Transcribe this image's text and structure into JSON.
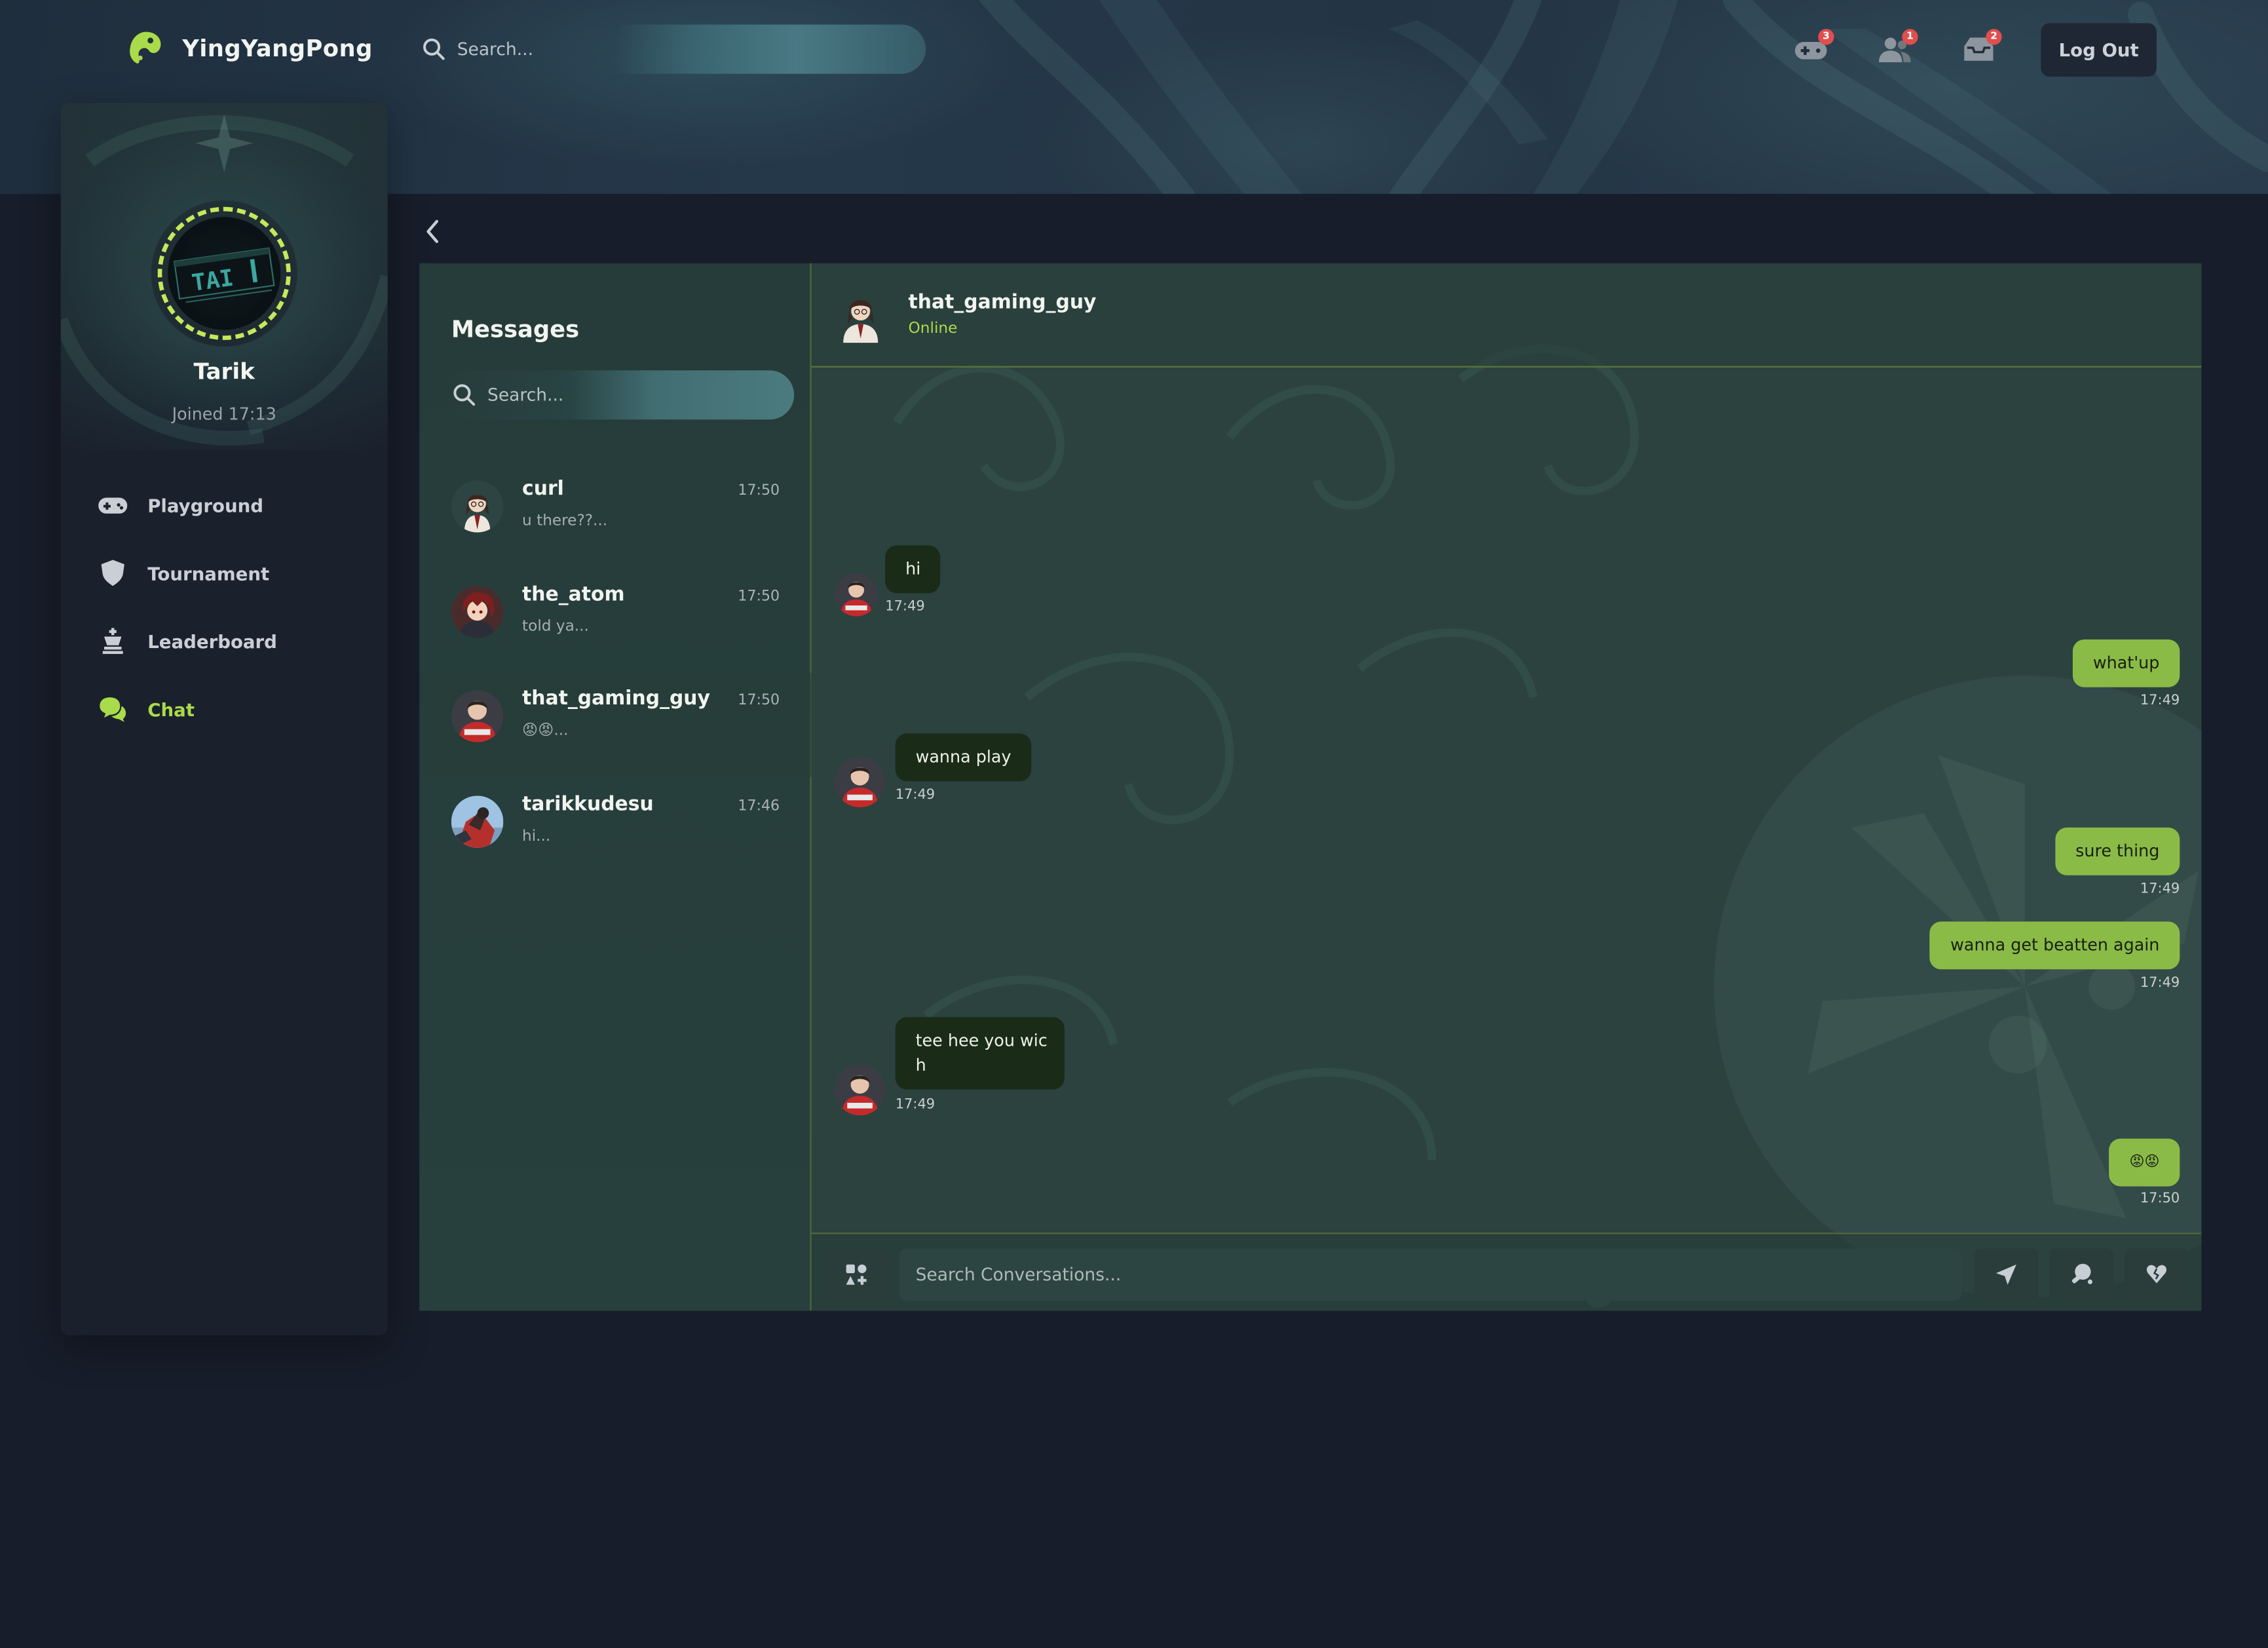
{
  "app": {
    "name": "YingYangPong"
  },
  "topbar": {
    "search_placeholder": "Search...",
    "badges": {
      "games": "3",
      "friends": "1",
      "inbox": "2"
    },
    "logout_label": "Log Out"
  },
  "profile": {
    "name": "Tarik",
    "joined": "Joined 17:13"
  },
  "sidebar": {
    "items": [
      {
        "label": "Playground",
        "icon": "gamepad-icon"
      },
      {
        "label": "Tournament",
        "icon": "shield-icon"
      },
      {
        "label": "Leaderboard",
        "icon": "chess-king-icon"
      },
      {
        "label": "Chat",
        "icon": "chat-bubbles-icon"
      }
    ]
  },
  "conversations": {
    "title": "Messages",
    "search_placeholder": "Search...",
    "items": [
      {
        "name": "curl",
        "time": "17:50",
        "preview": "u there??..."
      },
      {
        "name": "the_atom",
        "time": "17:50",
        "preview": "told ya..."
      },
      {
        "name": "that_gaming_guy",
        "time": "17:50",
        "preview": "😡😡..."
      },
      {
        "name": "tarikkudesu",
        "time": "17:46",
        "preview": "hi..."
      }
    ]
  },
  "chat": {
    "contact_name": "that_gaming_guy",
    "status": "Online",
    "messages": [
      {
        "text": "hi",
        "time": "17:49"
      },
      {
        "text": "what'up",
        "time": "17:49"
      },
      {
        "text": "wanna play",
        "time": "17:49"
      },
      {
        "text": "sure thing",
        "time": "17:49"
      },
      {
        "text": "wanna get beatten again",
        "time": "17:49"
      },
      {
        "text": "tee hee you wic",
        "text2": "h",
        "time": "17:49"
      },
      {
        "text": "😡😡",
        "time": "17:50"
      }
    ],
    "composer_placeholder": "Search Conversations..."
  },
  "colors": {
    "accent": "#a9db4a",
    "bubble_out": "#8bbb47",
    "bubble_in": "#1a2b18",
    "badge": "#e04e4e"
  }
}
